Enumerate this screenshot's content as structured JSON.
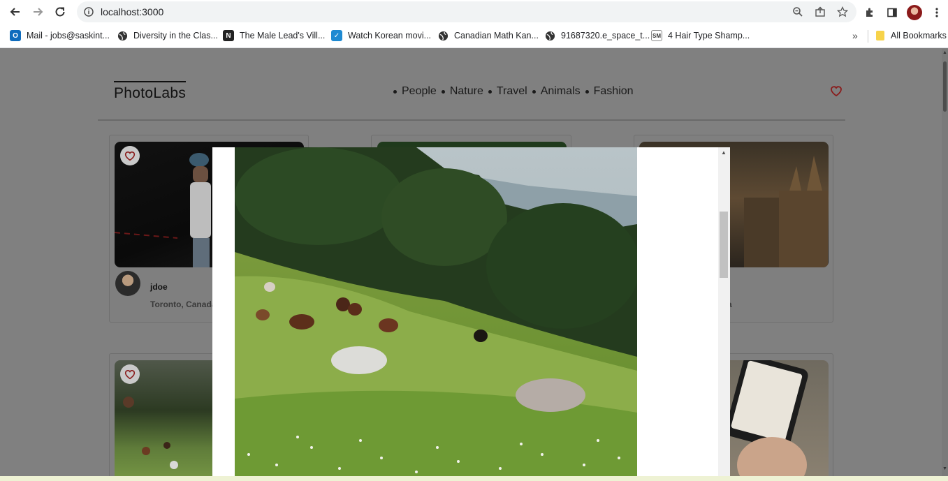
{
  "browser": {
    "url": "localhost:3000",
    "bookmarks": [
      {
        "label": "Mail - jobs@saskint...",
        "icon": "outlook-icon",
        "color": "#0f6cbd"
      },
      {
        "label": "Diversity in the Clas...",
        "icon": "globe-icon",
        "color": "#333333"
      },
      {
        "label": "The Male Lead's Vill...",
        "icon": "n-icon",
        "color": "#222222"
      },
      {
        "label": "Watch Korean movi...",
        "icon": "check-icon",
        "color": "#1f8ad2"
      },
      {
        "label": "Canadian Math Kan...",
        "icon": "globe-icon",
        "color": "#333333"
      },
      {
        "label": "91687320.e_space_t...",
        "icon": "globe-icon",
        "color": "#333333"
      },
      {
        "label": "4 Hair Type Shamp...",
        "icon": "sm-icon",
        "color": "#555555"
      }
    ],
    "all_bookmarks": "All Bookmarks"
  },
  "app": {
    "logo": "PhotoLabs",
    "topics": [
      "People",
      "Nature",
      "Travel",
      "Animals",
      "Fashion"
    ],
    "accent": "#c0392b"
  },
  "photos": [
    {
      "username": "jdoe",
      "location": "Toronto, Canada"
    },
    {
      "location_fragment": "a"
    }
  ]
}
